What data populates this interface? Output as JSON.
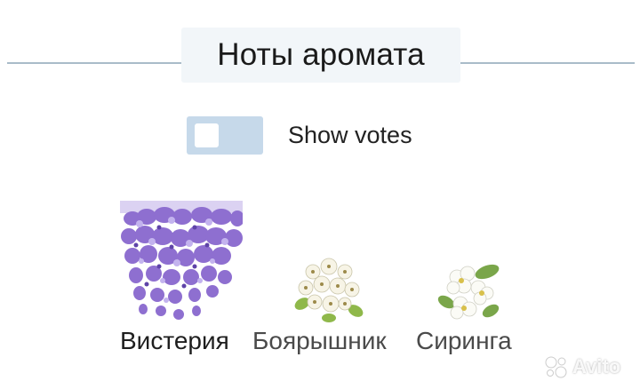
{
  "section": {
    "title": "Ноты аромата"
  },
  "toggle": {
    "label": "Show votes",
    "on": false
  },
  "notes": [
    {
      "name": "Вистерия",
      "icon": "wisteria-icon"
    },
    {
      "name": "Боярышник",
      "icon": "hawthorn-icon"
    },
    {
      "name": "Сиринга",
      "icon": "mock-orange-icon"
    }
  ],
  "watermark": {
    "text": "Avito",
    "icon": "avito-logo-icon"
  },
  "colors": {
    "divider": "#a9bcc9",
    "title_bg": "#f2f6f9",
    "toggle_bg": "#c6d9ea",
    "wisteria": "#8e6fd0",
    "blossom": "#f7f4e6"
  }
}
